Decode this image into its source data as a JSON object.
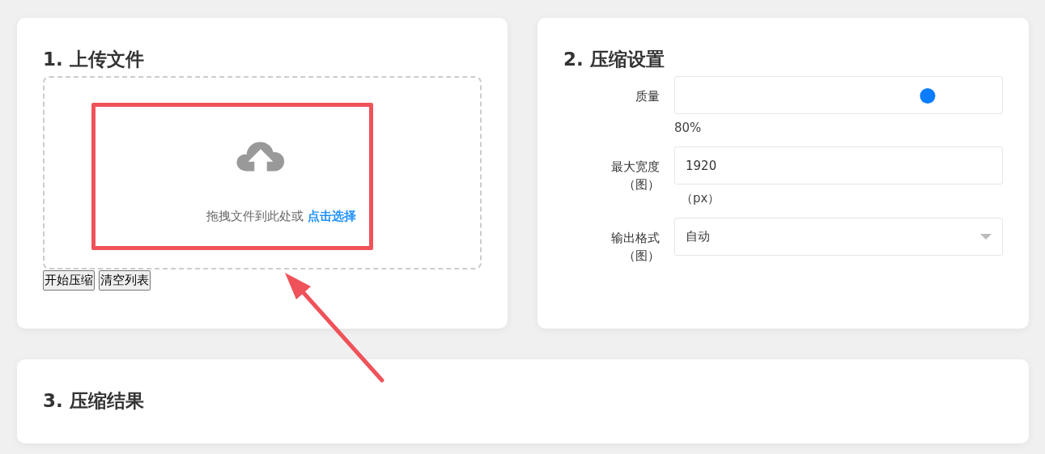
{
  "upload": {
    "title": "1. 上传文件",
    "dropzone": {
      "hint": "拖拽文件到此处或",
      "link": "点击选择"
    },
    "buttons": [
      "开始压缩",
      "清空列表"
    ]
  },
  "settings": {
    "title": "2. 压缩设置",
    "fields": [
      {
        "kind": "slider",
        "label": "质量",
        "level": 0.8,
        "reading": "80%"
      },
      {
        "kind": "number",
        "label": "最大宽度（图）",
        "value": "1920",
        "unit": "（px）"
      },
      {
        "kind": "select",
        "label": "输出格式（图）",
        "value": "自动"
      }
    ]
  },
  "results": {
    "title": "3. 压缩结果"
  },
  "annotations": {
    "highlight_box": true,
    "arrow": true
  }
}
